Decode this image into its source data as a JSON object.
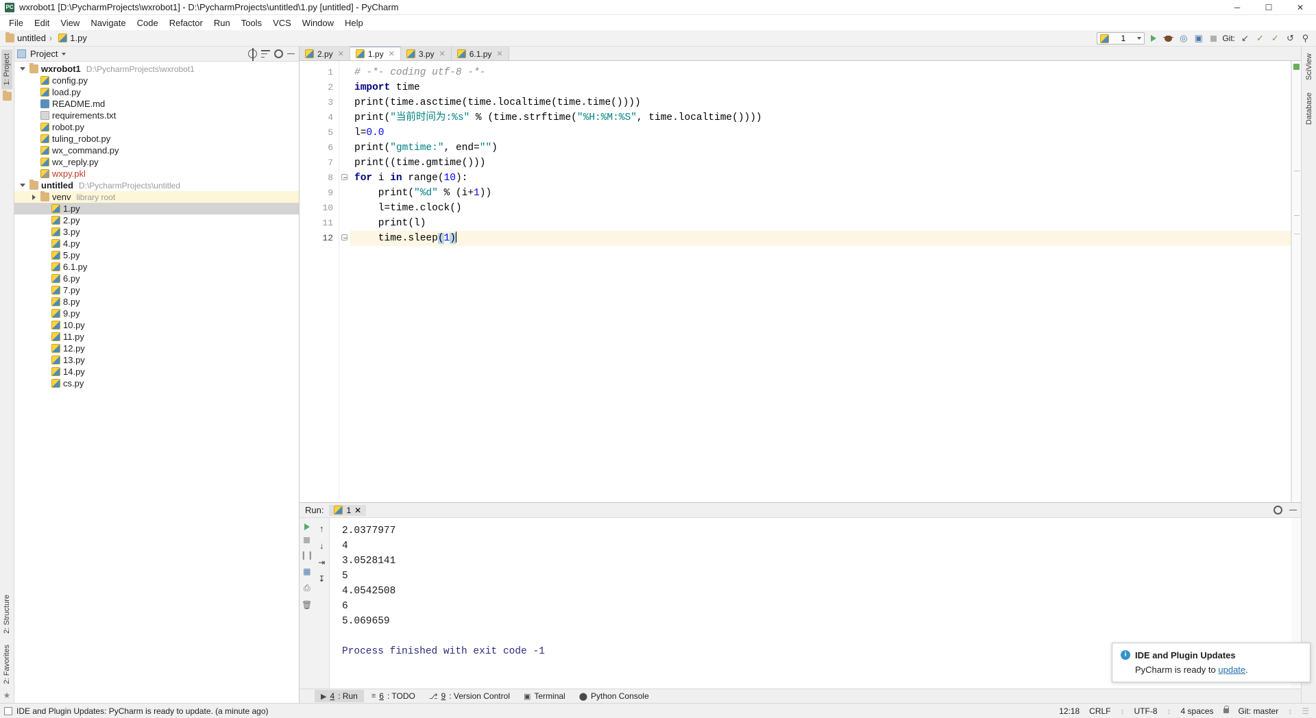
{
  "window": {
    "title": "wxrobot1 [D:\\PycharmProjects\\wxrobot1] - D:\\PycharmProjects\\untitled\\1.py [untitled] - PyCharm",
    "app_icon": "PC",
    "minimize": "─",
    "maximize": "☐",
    "close": "✕"
  },
  "menubar": {
    "items": [
      "File",
      "Edit",
      "View",
      "Navigate",
      "Code",
      "Refactor",
      "Run",
      "Tools",
      "VCS",
      "Window",
      "Help"
    ]
  },
  "navbar": {
    "crumbs": [
      {
        "label": "untitled",
        "icon": "folder-icon"
      },
      {
        "label": "1.py",
        "icon": "python-file-icon"
      }
    ],
    "run_config": "1",
    "git_label": "Git:"
  },
  "left_strip": {
    "project_tab": "1: Project",
    "structure_tab": "2: Structure",
    "favorites_tab": "2: Favorites"
  },
  "right_strip": {
    "sciview_tab": "SciView",
    "database_tab": "Database"
  },
  "project_panel": {
    "title": "Project",
    "tree": [
      {
        "indent": 0,
        "twisty": "down",
        "icon": "folder",
        "label": "wxrobot1",
        "bold": true,
        "path": "D:\\PycharmProjects\\wxrobot1",
        "state": "none"
      },
      {
        "indent": 1,
        "twisty": "none",
        "icon": "py",
        "label": "config.py",
        "bold": false,
        "path": "",
        "state": "none"
      },
      {
        "indent": 1,
        "twisty": "none",
        "icon": "py",
        "label": "load.py",
        "bold": false,
        "path": "",
        "state": "none"
      },
      {
        "indent": 1,
        "twisty": "none",
        "icon": "md",
        "label": "README.md",
        "bold": false,
        "path": "",
        "state": "none"
      },
      {
        "indent": 1,
        "twisty": "none",
        "icon": "txt",
        "label": "requirements.txt",
        "bold": false,
        "path": "",
        "state": "none"
      },
      {
        "indent": 1,
        "twisty": "none",
        "icon": "py",
        "label": "robot.py",
        "bold": false,
        "path": "",
        "state": "none"
      },
      {
        "indent": 1,
        "twisty": "none",
        "icon": "py",
        "label": "tuling_robot.py",
        "bold": false,
        "path": "",
        "state": "none"
      },
      {
        "indent": 1,
        "twisty": "none",
        "icon": "py",
        "label": "wx_command.py",
        "bold": false,
        "path": "",
        "state": "none"
      },
      {
        "indent": 1,
        "twisty": "none",
        "icon": "py",
        "label": "wx_reply.py",
        "bold": false,
        "path": "",
        "state": "none"
      },
      {
        "indent": 1,
        "twisty": "none",
        "icon": "pkl",
        "label": "wxpy.pkl",
        "bold": false,
        "path": "",
        "state": "red"
      },
      {
        "indent": 0,
        "twisty": "down",
        "icon": "folder",
        "label": "untitled",
        "bold": true,
        "path": "D:\\PycharmProjects\\untitled",
        "state": "none"
      },
      {
        "indent": 1,
        "twisty": "right",
        "icon": "folder",
        "label": "venv",
        "bold": false,
        "path": "library root",
        "state": "hl"
      },
      {
        "indent": 2,
        "twisty": "none",
        "icon": "py",
        "label": "1.py",
        "bold": false,
        "path": "",
        "state": "sel"
      },
      {
        "indent": 2,
        "twisty": "none",
        "icon": "py",
        "label": "2.py",
        "bold": false,
        "path": "",
        "state": "none"
      },
      {
        "indent": 2,
        "twisty": "none",
        "icon": "py",
        "label": "3.py",
        "bold": false,
        "path": "",
        "state": "none"
      },
      {
        "indent": 2,
        "twisty": "none",
        "icon": "py",
        "label": "4.py",
        "bold": false,
        "path": "",
        "state": "none"
      },
      {
        "indent": 2,
        "twisty": "none",
        "icon": "py",
        "label": "5.py",
        "bold": false,
        "path": "",
        "state": "none"
      },
      {
        "indent": 2,
        "twisty": "none",
        "icon": "py",
        "label": "6.1.py",
        "bold": false,
        "path": "",
        "state": "none"
      },
      {
        "indent": 2,
        "twisty": "none",
        "icon": "py",
        "label": "6.py",
        "bold": false,
        "path": "",
        "state": "none"
      },
      {
        "indent": 2,
        "twisty": "none",
        "icon": "py",
        "label": "7.py",
        "bold": false,
        "path": "",
        "state": "none"
      },
      {
        "indent": 2,
        "twisty": "none",
        "icon": "py",
        "label": "8.py",
        "bold": false,
        "path": "",
        "state": "none"
      },
      {
        "indent": 2,
        "twisty": "none",
        "icon": "py",
        "label": "9.py",
        "bold": false,
        "path": "",
        "state": "none"
      },
      {
        "indent": 2,
        "twisty": "none",
        "icon": "py",
        "label": "10.py",
        "bold": false,
        "path": "",
        "state": "none"
      },
      {
        "indent": 2,
        "twisty": "none",
        "icon": "py",
        "label": "11.py",
        "bold": false,
        "path": "",
        "state": "none"
      },
      {
        "indent": 2,
        "twisty": "none",
        "icon": "py",
        "label": "12.py",
        "bold": false,
        "path": "",
        "state": "none"
      },
      {
        "indent": 2,
        "twisty": "none",
        "icon": "py",
        "label": "13.py",
        "bold": false,
        "path": "",
        "state": "none"
      },
      {
        "indent": 2,
        "twisty": "none",
        "icon": "py",
        "label": "14.py",
        "bold": false,
        "path": "",
        "state": "none"
      },
      {
        "indent": 2,
        "twisty": "none",
        "icon": "py",
        "label": "cs.py",
        "bold": false,
        "path": "",
        "state": "none"
      }
    ]
  },
  "editor": {
    "tabs": [
      {
        "label": "2.py",
        "active": false
      },
      {
        "label": "1.py",
        "active": true
      },
      {
        "label": "3.py",
        "active": false
      },
      {
        "label": "6.1.py",
        "active": false
      }
    ],
    "line_numbers": [
      "1",
      "2",
      "3",
      "4",
      "5",
      "6",
      "7",
      "8",
      "9",
      "10",
      "11",
      "12"
    ],
    "current_line": 12,
    "lines": [
      "# -*- coding utf-8 -*-",
      "import time",
      "print(time.asctime(time.localtime(time.time())))",
      "print(\"当前时间为:%s\" % (time.strftime(\"%H:%M:%S\", time.localtime())))",
      "l=0.0",
      "print(\"gmtime:\", end=\"\")",
      "print((time.gmtime()))",
      "for i in range(10):",
      "    print(\"%d\" % (i+1))",
      "    l=time.clock()",
      "    print(l)",
      "    time.sleep(1)"
    ]
  },
  "run_panel": {
    "label": "Run:",
    "tab_label": "1",
    "output": [
      "2.0377977",
      "4",
      "3.0528141",
      "5",
      "4.0542508",
      "6",
      "5.069659",
      "",
      "Process finished with exit code -1"
    ]
  },
  "bottom_tabs": [
    {
      "num": "4",
      "label": ": Run",
      "active": true,
      "icon": "play-icon"
    },
    {
      "num": "6",
      "label": ": TODO",
      "active": false,
      "icon": "todo-icon"
    },
    {
      "num": "9",
      "label": ": Version Control",
      "active": false,
      "icon": "branch-icon"
    },
    {
      "num": "",
      "label": "Terminal",
      "active": false,
      "icon": "terminal-icon"
    },
    {
      "num": "",
      "label": "Python Console",
      "active": false,
      "icon": "python-icon"
    }
  ],
  "statusbar": {
    "message": "IDE and Plugin Updates: PyCharm is ready to update. (a minute ago)",
    "caret": "12:18",
    "line_separator": "CRLF",
    "encoding": "UTF-8",
    "indent": "4 spaces",
    "branch": "Git: master"
  },
  "notification": {
    "title": "IDE and Plugin Updates",
    "body_prefix": "PyCharm is ready to ",
    "link": "update",
    "body_suffix": "."
  }
}
